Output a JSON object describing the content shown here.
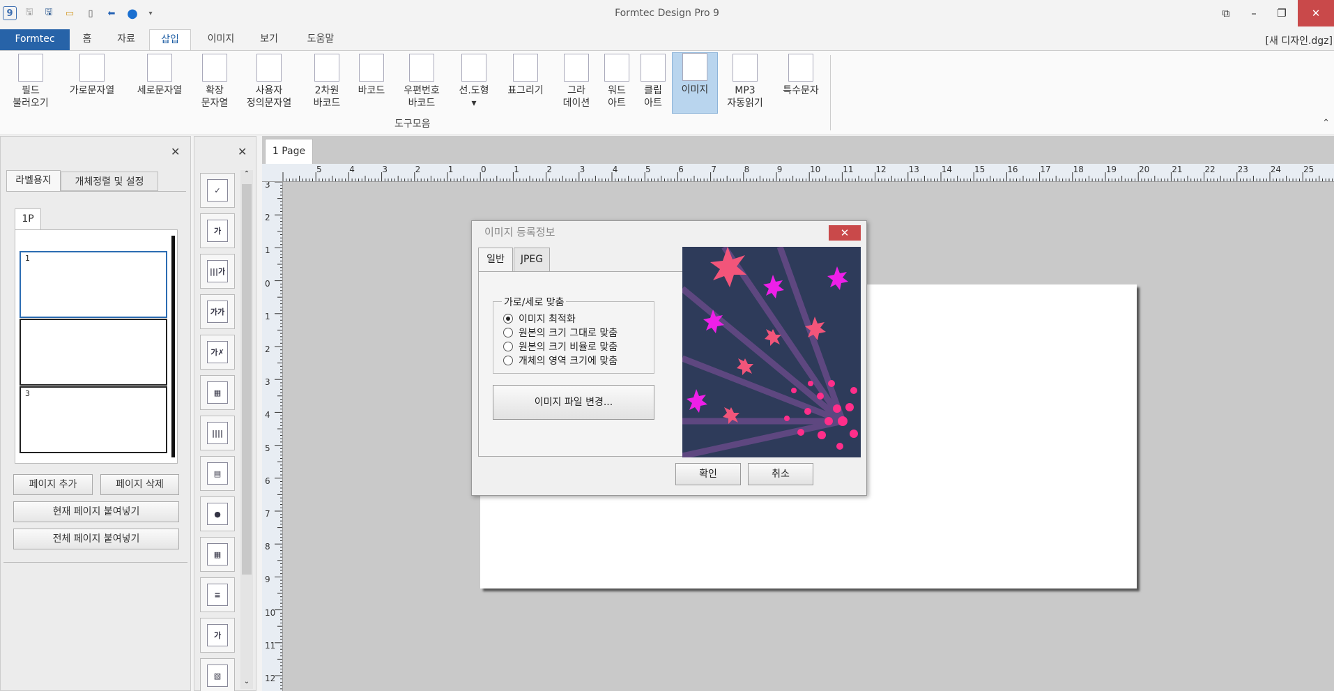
{
  "window": {
    "title": "Formtec Design Pro 9",
    "doc_name": "[새 디자인.dgz]"
  },
  "quick_access": {
    "app_icon": "9"
  },
  "menu": {
    "tabs": [
      "Formtec",
      "홈",
      "자료",
      "삽입",
      "이미지",
      "보기",
      "도움말"
    ],
    "active": "삽입"
  },
  "ribbon": {
    "group_label": "도구모음",
    "buttons": [
      {
        "l1": "필드",
        "l2": "불러오기",
        "icon": "field-load-icon"
      },
      {
        "l1": "가로문자열",
        "l2": "",
        "icon": "horizontal-text-icon"
      },
      {
        "l1": "세로문자열",
        "l2": "",
        "icon": "vertical-text-icon"
      },
      {
        "l1": "확장",
        "l2": "문자열",
        "icon": "extended-text-icon"
      },
      {
        "l1": "사용자",
        "l2": "정의문자열",
        "icon": "custom-text-icon"
      },
      {
        "l1": "2차원",
        "l2": "바코드",
        "icon": "qr-code-icon"
      },
      {
        "l1": "바코드",
        "l2": "",
        "icon": "barcode-icon"
      },
      {
        "l1": "우편번호",
        "l2": "바코드",
        "icon": "postal-barcode-icon"
      },
      {
        "l1": "선.도형",
        "l2": "▾",
        "icon": "shape-icon"
      },
      {
        "l1": "표그리기",
        "l2": "",
        "icon": "table-icon"
      },
      {
        "l1": "그라",
        "l2": "데이션",
        "icon": "gradation-icon"
      },
      {
        "l1": "워드",
        "l2": "아트",
        "icon": "word-art-icon"
      },
      {
        "l1": "클립",
        "l2": "아트",
        "icon": "clip-art-icon"
      },
      {
        "l1": "이미지",
        "l2": "",
        "icon": "image-icon"
      },
      {
        "l1": "MP3",
        "l2": "자동읽기",
        "icon": "mp3-icon"
      },
      {
        "l1": "특수문자",
        "l2": "",
        "icon": "special-char-icon"
      }
    ]
  },
  "left_panel": {
    "tabs": [
      "라벨용지",
      "개체정렬 및 설정"
    ],
    "page_tab": "1P",
    "labels": [
      "1",
      "",
      "3"
    ],
    "buttons": {
      "add": "페이지 추가",
      "delete": "페이지 삭제",
      "paste_current": "현재 페이지 붙여넣기",
      "paste_all": "전체 페이지 붙여넣기"
    }
  },
  "toolbox": {
    "glyphs": [
      "✓",
      "가",
      "|||가",
      "가가",
      "가✗",
      "▦",
      "||||",
      "▤",
      "●",
      "▦",
      "≡",
      "가",
      "▧"
    ]
  },
  "canvas": {
    "page_tab": "1 Page",
    "h_ruler": [
      "5",
      "4",
      "3",
      "2",
      "1",
      "0",
      "1",
      "2",
      "3",
      "4",
      "5",
      "6",
      "7",
      "8",
      "9",
      "10",
      "11",
      "12",
      "13",
      "14",
      "15",
      "16",
      "17",
      "18",
      "19",
      "20",
      "21",
      "22",
      "23",
      "24",
      "25"
    ],
    "v_ruler": [
      "3",
      "2",
      "1",
      "0",
      "1",
      "2",
      "3",
      "4",
      "5",
      "6",
      "7",
      "8",
      "9",
      "10",
      "11",
      "12"
    ]
  },
  "dialog": {
    "title": "이미지 등록정보",
    "tabs": [
      "일반",
      "JPEG"
    ],
    "fit_legend": "가로/세로 맞춤",
    "options": [
      "이미지 최적화",
      "원본의 크기 그대로 맞춤",
      "원본의 크기 비율로 맞춤",
      "개체의 영역 크기에 맞춤"
    ],
    "selected_option": 0,
    "change_file": "이미지 파일 변경...",
    "ok": "확인",
    "cancel": "취소"
  }
}
